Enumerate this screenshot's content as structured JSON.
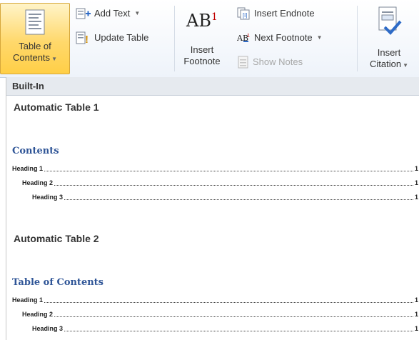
{
  "ribbon": {
    "toc_label_line1": "Table of",
    "toc_label_line2": "Contents",
    "add_text": "Add Text",
    "update_table": "Update Table",
    "insert_footnote_line1": "Insert",
    "insert_footnote_line2": "Footnote",
    "ab_glyph": "AB",
    "ab_sup": "1",
    "insert_endnote": "Insert Endnote",
    "next_footnote": "Next Footnote",
    "show_notes": "Show Notes",
    "insert_citation_line1": "Insert",
    "insert_citation_line2": "Citation"
  },
  "gallery": {
    "section_header": "Built-In",
    "items": [
      {
        "title": "Automatic Table 1",
        "heading": "Contents",
        "rows": [
          {
            "text": "Heading 1",
            "page": "1"
          },
          {
            "text": "Heading 2",
            "page": "1"
          },
          {
            "text": "Heading 3",
            "page": "1"
          }
        ]
      },
      {
        "title": "Automatic Table 2",
        "heading": "Table of Contents",
        "rows": [
          {
            "text": "Heading 1",
            "page": "1"
          },
          {
            "text": "Heading 2",
            "page": "1"
          },
          {
            "text": "Heading 3",
            "page": "1"
          }
        ]
      }
    ]
  },
  "colors": {
    "accent": "#ffd86b",
    "toc_heading": "#2f5597"
  }
}
